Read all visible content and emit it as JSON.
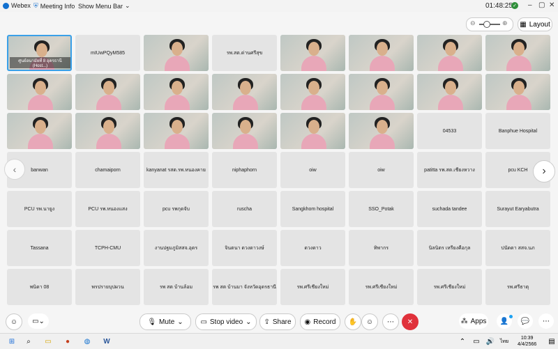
{
  "app": {
    "name": "Webex",
    "meeting_info": "Meeting Info",
    "show_menu_bar": "Show Menu Bar",
    "timer": "01:48:25"
  },
  "toolbar": {
    "layout_label": "Layout"
  },
  "grid": {
    "tiles": [
      {
        "type": "video",
        "label": "ศูนย์อนามัยที่ 8 อุดรธานี (Host...)",
        "host": true
      },
      {
        "type": "name",
        "label": "mIUwPQyM585"
      },
      {
        "type": "video",
        "label": ""
      },
      {
        "type": "name",
        "label": "รพ.สต.ด่านศรีสุข"
      },
      {
        "type": "video",
        "label": ""
      },
      {
        "type": "video",
        "label": ""
      },
      {
        "type": "video",
        "label": ""
      },
      {
        "type": "video",
        "label": ""
      },
      {
        "type": "video",
        "label": ""
      },
      {
        "type": "video",
        "label": ""
      },
      {
        "type": "video",
        "label": ""
      },
      {
        "type": "video",
        "label": ""
      },
      {
        "type": "video",
        "label": ""
      },
      {
        "type": "video",
        "label": ""
      },
      {
        "type": "video",
        "label": ""
      },
      {
        "type": "video",
        "label": ""
      },
      {
        "type": "video",
        "label": ""
      },
      {
        "type": "video",
        "label": ""
      },
      {
        "type": "video",
        "label": ""
      },
      {
        "type": "video",
        "label": ""
      },
      {
        "type": "video",
        "label": ""
      },
      {
        "type": "video",
        "label": ""
      },
      {
        "type": "name",
        "label": "04533"
      },
      {
        "type": "name",
        "label": "Banphue Hospital"
      },
      {
        "type": "name",
        "label": "banwan"
      },
      {
        "type": "name",
        "label": "chamaiporn"
      },
      {
        "type": "name",
        "label": "kanyanat รสต.รพ.หนองคาย"
      },
      {
        "type": "name",
        "label": "niphaphorn"
      },
      {
        "type": "name",
        "label": "oiw"
      },
      {
        "type": "name",
        "label": "oiw"
      },
      {
        "type": "name",
        "label": "patitta รพ.สต.เชียงหวาง"
      },
      {
        "type": "name",
        "label": "pcu KCH"
      },
      {
        "type": "name",
        "label": "PCU รพ.นายูง"
      },
      {
        "type": "name",
        "label": "PCU รพ.หนองแสง"
      },
      {
        "type": "name",
        "label": "pcu รพกุดจับ"
      },
      {
        "type": "name",
        "label": "ruscha"
      },
      {
        "type": "name",
        "label": "Sangkhom hospital"
      },
      {
        "type": "name",
        "label": "SSO_Potak"
      },
      {
        "type": "name",
        "label": "suchada tandee"
      },
      {
        "type": "name",
        "label": "Surayut Earyabutra"
      },
      {
        "type": "name",
        "label": "Tassana"
      },
      {
        "type": "name",
        "label": "TCPH-CMU"
      },
      {
        "type": "name",
        "label": "งานปฐมภูมิสสจ.อุดร"
      },
      {
        "type": "name",
        "label": "จินตนา ดวงดาวงษ์"
      },
      {
        "type": "name",
        "label": "ดวงดาว"
      },
      {
        "type": "name",
        "label": "ทิพากร"
      },
      {
        "type": "name",
        "label": "นิลนิตร เหรียงคือกุล"
      },
      {
        "type": "name",
        "label": "ปนัดดา สสจ.นภ"
      },
      {
        "type": "name",
        "label": "พนิดา 08"
      },
      {
        "type": "name",
        "label": "พรปรายบุปผวน"
      },
      {
        "type": "name",
        "label": "รพ สต บ้านล้อม"
      },
      {
        "type": "name",
        "label": "รพ สต บ้านมา จังหวัดอุดรธานี"
      },
      {
        "type": "name",
        "label": "รพ.ศรีเชียงใหม่"
      },
      {
        "type": "name",
        "label": "รพ.ศรีเชียงใหม่"
      },
      {
        "type": "name",
        "label": "รพ.ศรีเชียงใหม่"
      },
      {
        "type": "name",
        "label": "รพ.ศรีธาตุ"
      }
    ]
  },
  "controls": {
    "mute": "Mute",
    "stop_video": "Stop video",
    "share": "Share",
    "record": "Record",
    "apps": "Apps"
  },
  "taskbar": {
    "time": "10:39",
    "date": "4/4/2566"
  }
}
